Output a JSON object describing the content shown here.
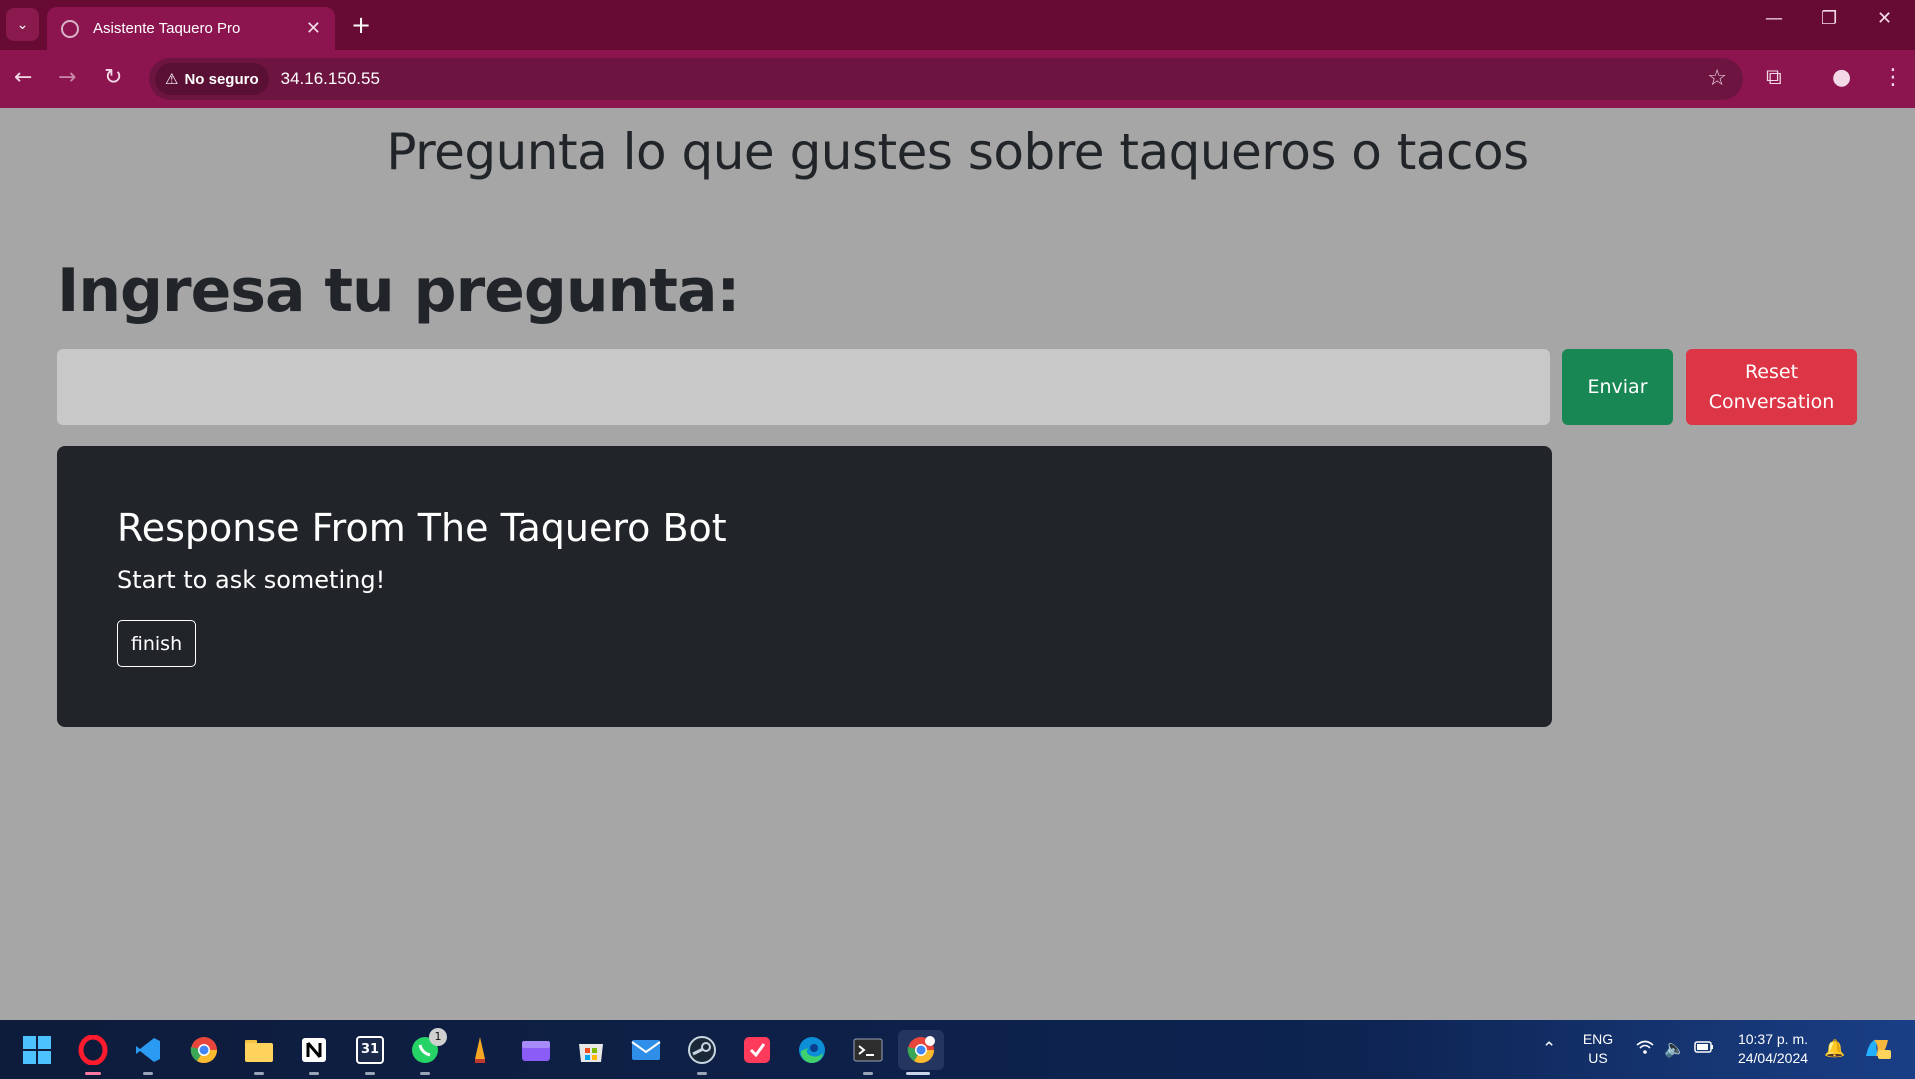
{
  "browser": {
    "tab_title": "Asistente Taquero Pro",
    "security_label": "No seguro",
    "url": "34.16.150.55"
  },
  "page": {
    "title": "Pregunta lo que gustes sobre taqueros o tacos",
    "prompt_label": "Ingresa tu pregunta:",
    "input_value": "",
    "send_label": "Enviar",
    "reset_label_line1": "Reset",
    "reset_label_line2": "Conversation",
    "response_title": "Response From The Taquero Bot",
    "response_text": "Start to ask someting!",
    "finish_label": "finish"
  },
  "taskbar": {
    "whatsapp_badge": "1",
    "calendar_day": "31",
    "language_line1": "ENG",
    "language_line2": "US",
    "time": "10:37 p. m.",
    "date": "24/04/2024"
  },
  "colors": {
    "chrome_dark": "#670b34",
    "chrome": "#8c1550",
    "page_bg": "#a6a6a6",
    "send": "#198754",
    "reset": "#dc3545",
    "card": "#212529"
  }
}
